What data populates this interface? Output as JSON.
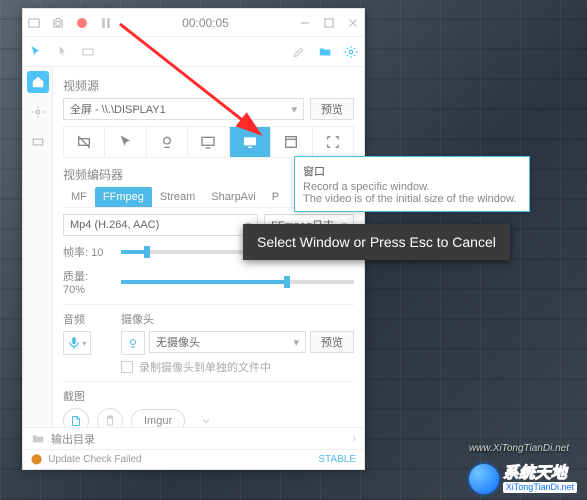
{
  "titlebar": {
    "timer": "00:00:05"
  },
  "sections": {
    "video_source": "视频源",
    "video_encoder": "视频编码器",
    "audio": "音频",
    "camera": "摄像头",
    "screenshot": "截图"
  },
  "source_select": {
    "value": "全屏 - \\\\.\\DISPLAY1"
  },
  "preview_btn": "预览",
  "encoder_tabs": [
    "MF",
    "FFmpeg",
    "Stream",
    "SharpAvi",
    "P"
  ],
  "encoder_active": "FFmpeg",
  "encoder_format": {
    "value": "Mp4 (H.264, AAC)"
  },
  "encoder_sink": {
    "value": "FFmpeg日志"
  },
  "sliders": {
    "fps_label": "帧率:",
    "fps_value": "10",
    "fps_pct": 10,
    "quality_label": "质量:",
    "quality_value": "70%",
    "quality_pct": 70
  },
  "camera_select": {
    "value": "无摄像头"
  },
  "camera_checkbox_label": "录制摄像头到单独的文件中",
  "screenshot_target": "Imgur",
  "outdir_label": "输出目录",
  "footer": {
    "update": "Update Check Failed",
    "channel": "STABLE"
  },
  "tooltip": {
    "title": "窗口",
    "line1": "Record a specific window.",
    "line2": "The video is of the initial size of the window."
  },
  "overlay": "Select Window or Press Esc to Cancel",
  "watermark1": "www.XiTongTianDi.net",
  "watermark2": {
    "cn": "系统天地",
    "url": "XiTongTianDi.net"
  }
}
